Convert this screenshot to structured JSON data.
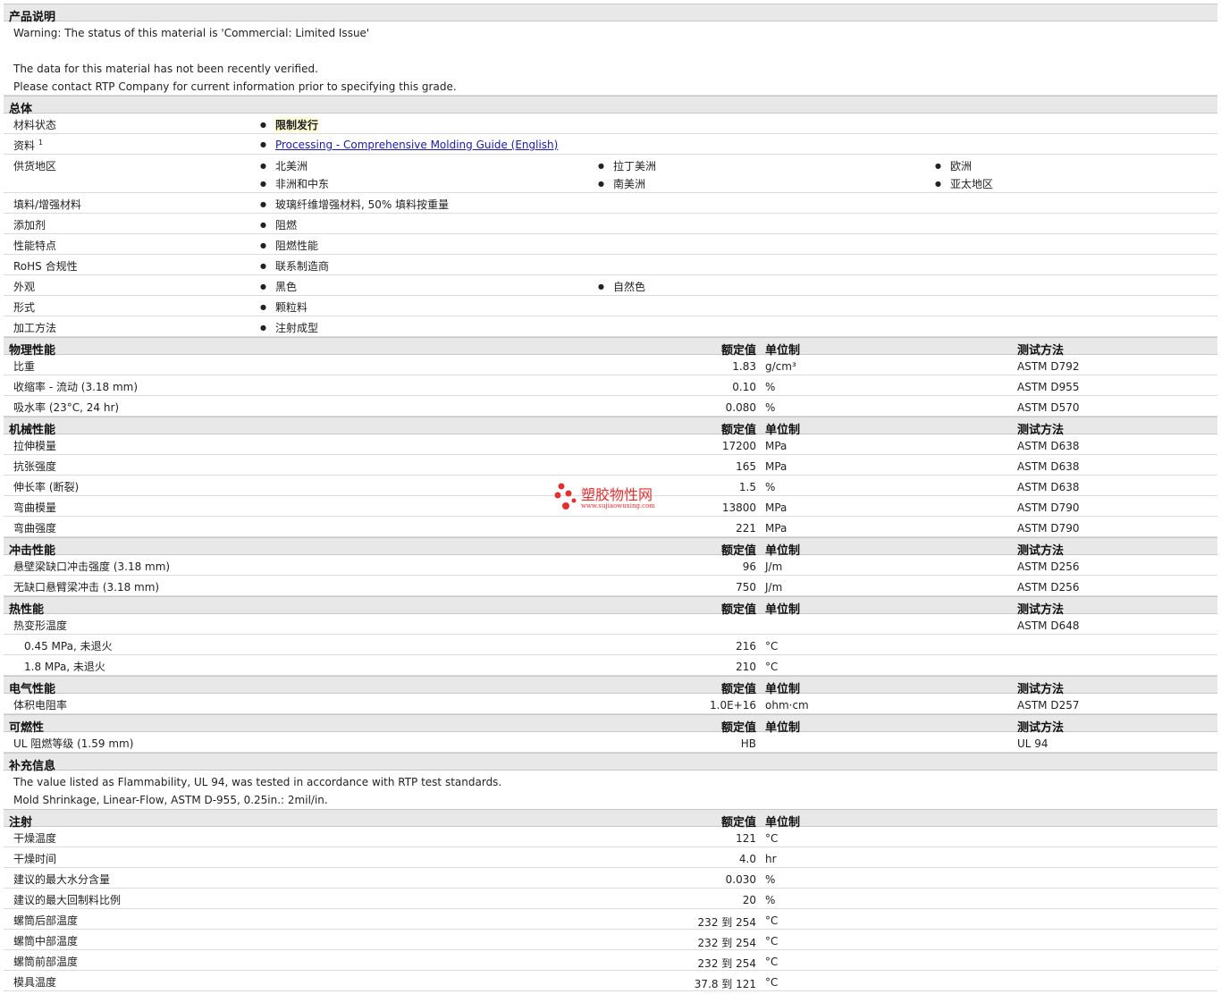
{
  "desc": {
    "title": "产品说明",
    "lines": [
      "Warning: The status of this material is 'Commercial: Limited Issue'",
      "The data for this material has not been recently verified.",
      "Please contact RTP Company for current information prior to specifying this grade."
    ]
  },
  "general": {
    "title": "总体",
    "status_label": "材料状态",
    "status_value": "限制发行",
    "doc_label": "资料",
    "doc_sup": "1",
    "doc_link": "Processing - Comprehensive Molding Guide (English)",
    "region_label": "供货地区",
    "regions": [
      "北美洲",
      "拉丁美洲",
      "欧洲",
      "非洲和中东",
      "南美洲",
      "亚太地区"
    ],
    "filler_label": "填料/增强材料",
    "filler_value": "玻璃纤维增强材料, 50% 填料按重量",
    "additive_label": "添加剂",
    "additive_value": "阻燃",
    "feature_label": "性能特点",
    "feature_value": "阻燃性能",
    "rohs_label": "RoHS 合规性",
    "rohs_value": "联系制造商",
    "look_label": "外观",
    "look_values": [
      "黑色",
      "自然色"
    ],
    "form_label": "形式",
    "form_value": "颗粒料",
    "proc_label": "加工方法",
    "proc_value": "注射成型"
  },
  "col": {
    "value": "额定值",
    "unit": "单位制",
    "method": "测试方法"
  },
  "physical": {
    "title": "物理性能",
    "rows": [
      {
        "name": "比重",
        "value": "1.83",
        "unit": "g/cm³",
        "method": "ASTM D792"
      },
      {
        "name": "收缩率  - 流动  (3.18 mm)",
        "value": "0.10",
        "unit": "%",
        "method": "ASTM D955"
      },
      {
        "name": "吸水率  (23°C, 24 hr)",
        "value": "0.080",
        "unit": "%",
        "method": "ASTM D570"
      }
    ]
  },
  "mechanical": {
    "title": "机械性能",
    "rows": [
      {
        "name": "拉伸模量",
        "value": "17200",
        "unit": "MPa",
        "method": "ASTM D638"
      },
      {
        "name": "抗张强度",
        "value": "165",
        "unit": "MPa",
        "method": "ASTM D638"
      },
      {
        "name": "伸长率  (断裂)",
        "value": "1.5",
        "unit": "%",
        "method": "ASTM D638"
      },
      {
        "name": "弯曲模量",
        "value": "13800",
        "unit": "MPa",
        "method": "ASTM D790"
      },
      {
        "name": "弯曲强度",
        "value": "221",
        "unit": "MPa",
        "method": "ASTM D790"
      }
    ]
  },
  "impact": {
    "title": "冲击性能",
    "rows": [
      {
        "name": "悬壁梁缺口冲击强度  (3.18 mm)",
        "value": "96",
        "unit": "J/m",
        "method": "ASTM D256"
      },
      {
        "name": "无缺口悬臂梁冲击  (3.18 mm)",
        "value": "750",
        "unit": "J/m",
        "method": "ASTM D256"
      }
    ]
  },
  "thermal": {
    "title": "热性能",
    "head": {
      "name": "热变形温度",
      "method": "ASTM D648"
    },
    "rows": [
      {
        "name": "0.45 MPa, 未退火",
        "value": "216",
        "unit": "°C"
      },
      {
        "name": "1.8 MPa, 未退火",
        "value": "210",
        "unit": "°C"
      }
    ]
  },
  "electrical": {
    "title": "电气性能",
    "rows": [
      {
        "name": "体积电阻率",
        "value": "1.0E+16",
        "unit": "ohm·cm",
        "method": "ASTM D257"
      }
    ]
  },
  "flammability": {
    "title": "可燃性",
    "rows": [
      {
        "name": "UL 阻燃等级  (1.59 mm)",
        "value": "HB",
        "unit": "",
        "method": "UL 94"
      }
    ]
  },
  "supplement": {
    "title": "补充信息",
    "lines": [
      "The value listed as Flammability, UL 94, was tested in accordance with RTP test standards.",
      "Mold Shrinkage, Linear-Flow, ASTM D-955, 0.25in.: 2mil/in."
    ]
  },
  "injection": {
    "title": "注射",
    "rows": [
      {
        "name": "干燥温度",
        "value": "121",
        "unit": "°C"
      },
      {
        "name": "干燥时间",
        "value": "4.0",
        "unit": "hr"
      },
      {
        "name": "建议的最大水分含量",
        "value": "0.030",
        "unit": "%"
      },
      {
        "name": "建议的最大回制料比例",
        "value": "20",
        "unit": "%"
      },
      {
        "name": "螺筒后部温度",
        "value": "232 到  254",
        "unit": "°C"
      },
      {
        "name": "螺筒中部温度",
        "value": "232 到  254",
        "unit": "°C"
      },
      {
        "name": "螺筒前部温度",
        "value": "232 到  254",
        "unit": "°C"
      },
      {
        "name": "模具温度",
        "value": "37.8 到  121",
        "unit": "°C"
      }
    ]
  },
  "watermark": {
    "cn": "塑胶物性网",
    "url": "www.sujiaowuxing.com"
  }
}
